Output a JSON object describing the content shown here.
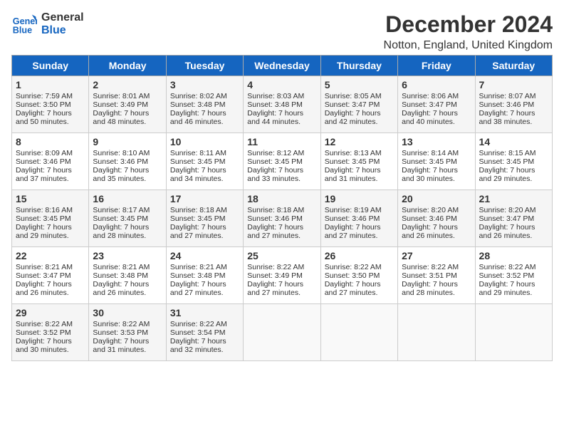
{
  "logo": {
    "line1": "General",
    "line2": "Blue"
  },
  "title": "December 2024",
  "subtitle": "Notton, England, United Kingdom",
  "days_of_week": [
    "Sunday",
    "Monday",
    "Tuesday",
    "Wednesday",
    "Thursday",
    "Friday",
    "Saturday"
  ],
  "weeks": [
    [
      {
        "day": "1",
        "sunrise": "Sunrise: 7:59 AM",
        "sunset": "Sunset: 3:50 PM",
        "daylight": "Daylight: 7 hours and 50 minutes."
      },
      {
        "day": "2",
        "sunrise": "Sunrise: 8:01 AM",
        "sunset": "Sunset: 3:49 PM",
        "daylight": "Daylight: 7 hours and 48 minutes."
      },
      {
        "day": "3",
        "sunrise": "Sunrise: 8:02 AM",
        "sunset": "Sunset: 3:48 PM",
        "daylight": "Daylight: 7 hours and 46 minutes."
      },
      {
        "day": "4",
        "sunrise": "Sunrise: 8:03 AM",
        "sunset": "Sunset: 3:48 PM",
        "daylight": "Daylight: 7 hours and 44 minutes."
      },
      {
        "day": "5",
        "sunrise": "Sunrise: 8:05 AM",
        "sunset": "Sunset: 3:47 PM",
        "daylight": "Daylight: 7 hours and 42 minutes."
      },
      {
        "day": "6",
        "sunrise": "Sunrise: 8:06 AM",
        "sunset": "Sunset: 3:47 PM",
        "daylight": "Daylight: 7 hours and 40 minutes."
      },
      {
        "day": "7",
        "sunrise": "Sunrise: 8:07 AM",
        "sunset": "Sunset: 3:46 PM",
        "daylight": "Daylight: 7 hours and 38 minutes."
      }
    ],
    [
      {
        "day": "8",
        "sunrise": "Sunrise: 8:09 AM",
        "sunset": "Sunset: 3:46 PM",
        "daylight": "Daylight: 7 hours and 37 minutes."
      },
      {
        "day": "9",
        "sunrise": "Sunrise: 8:10 AM",
        "sunset": "Sunset: 3:46 PM",
        "daylight": "Daylight: 7 hours and 35 minutes."
      },
      {
        "day": "10",
        "sunrise": "Sunrise: 8:11 AM",
        "sunset": "Sunset: 3:45 PM",
        "daylight": "Daylight: 7 hours and 34 minutes."
      },
      {
        "day": "11",
        "sunrise": "Sunrise: 8:12 AM",
        "sunset": "Sunset: 3:45 PM",
        "daylight": "Daylight: 7 hours and 33 minutes."
      },
      {
        "day": "12",
        "sunrise": "Sunrise: 8:13 AM",
        "sunset": "Sunset: 3:45 PM",
        "daylight": "Daylight: 7 hours and 31 minutes."
      },
      {
        "day": "13",
        "sunrise": "Sunrise: 8:14 AM",
        "sunset": "Sunset: 3:45 PM",
        "daylight": "Daylight: 7 hours and 30 minutes."
      },
      {
        "day": "14",
        "sunrise": "Sunrise: 8:15 AM",
        "sunset": "Sunset: 3:45 PM",
        "daylight": "Daylight: 7 hours and 29 minutes."
      }
    ],
    [
      {
        "day": "15",
        "sunrise": "Sunrise: 8:16 AM",
        "sunset": "Sunset: 3:45 PM",
        "daylight": "Daylight: 7 hours and 29 minutes."
      },
      {
        "day": "16",
        "sunrise": "Sunrise: 8:17 AM",
        "sunset": "Sunset: 3:45 PM",
        "daylight": "Daylight: 7 hours and 28 minutes."
      },
      {
        "day": "17",
        "sunrise": "Sunrise: 8:18 AM",
        "sunset": "Sunset: 3:45 PM",
        "daylight": "Daylight: 7 hours and 27 minutes."
      },
      {
        "day": "18",
        "sunrise": "Sunrise: 8:18 AM",
        "sunset": "Sunset: 3:46 PM",
        "daylight": "Daylight: 7 hours and 27 minutes."
      },
      {
        "day": "19",
        "sunrise": "Sunrise: 8:19 AM",
        "sunset": "Sunset: 3:46 PM",
        "daylight": "Daylight: 7 hours and 27 minutes."
      },
      {
        "day": "20",
        "sunrise": "Sunrise: 8:20 AM",
        "sunset": "Sunset: 3:46 PM",
        "daylight": "Daylight: 7 hours and 26 minutes."
      },
      {
        "day": "21",
        "sunrise": "Sunrise: 8:20 AM",
        "sunset": "Sunset: 3:47 PM",
        "daylight": "Daylight: 7 hours and 26 minutes."
      }
    ],
    [
      {
        "day": "22",
        "sunrise": "Sunrise: 8:21 AM",
        "sunset": "Sunset: 3:47 PM",
        "daylight": "Daylight: 7 hours and 26 minutes."
      },
      {
        "day": "23",
        "sunrise": "Sunrise: 8:21 AM",
        "sunset": "Sunset: 3:48 PM",
        "daylight": "Daylight: 7 hours and 26 minutes."
      },
      {
        "day": "24",
        "sunrise": "Sunrise: 8:21 AM",
        "sunset": "Sunset: 3:48 PM",
        "daylight": "Daylight: 7 hours and 27 minutes."
      },
      {
        "day": "25",
        "sunrise": "Sunrise: 8:22 AM",
        "sunset": "Sunset: 3:49 PM",
        "daylight": "Daylight: 7 hours and 27 minutes."
      },
      {
        "day": "26",
        "sunrise": "Sunrise: 8:22 AM",
        "sunset": "Sunset: 3:50 PM",
        "daylight": "Daylight: 7 hours and 27 minutes."
      },
      {
        "day": "27",
        "sunrise": "Sunrise: 8:22 AM",
        "sunset": "Sunset: 3:51 PM",
        "daylight": "Daylight: 7 hours and 28 minutes."
      },
      {
        "day": "28",
        "sunrise": "Sunrise: 8:22 AM",
        "sunset": "Sunset: 3:52 PM",
        "daylight": "Daylight: 7 hours and 29 minutes."
      }
    ],
    [
      {
        "day": "29",
        "sunrise": "Sunrise: 8:22 AM",
        "sunset": "Sunset: 3:52 PM",
        "daylight": "Daylight: 7 hours and 30 minutes."
      },
      {
        "day": "30",
        "sunrise": "Sunrise: 8:22 AM",
        "sunset": "Sunset: 3:53 PM",
        "daylight": "Daylight: 7 hours and 31 minutes."
      },
      {
        "day": "31",
        "sunrise": "Sunrise: 8:22 AM",
        "sunset": "Sunset: 3:54 PM",
        "daylight": "Daylight: 7 hours and 32 minutes."
      },
      null,
      null,
      null,
      null
    ]
  ]
}
